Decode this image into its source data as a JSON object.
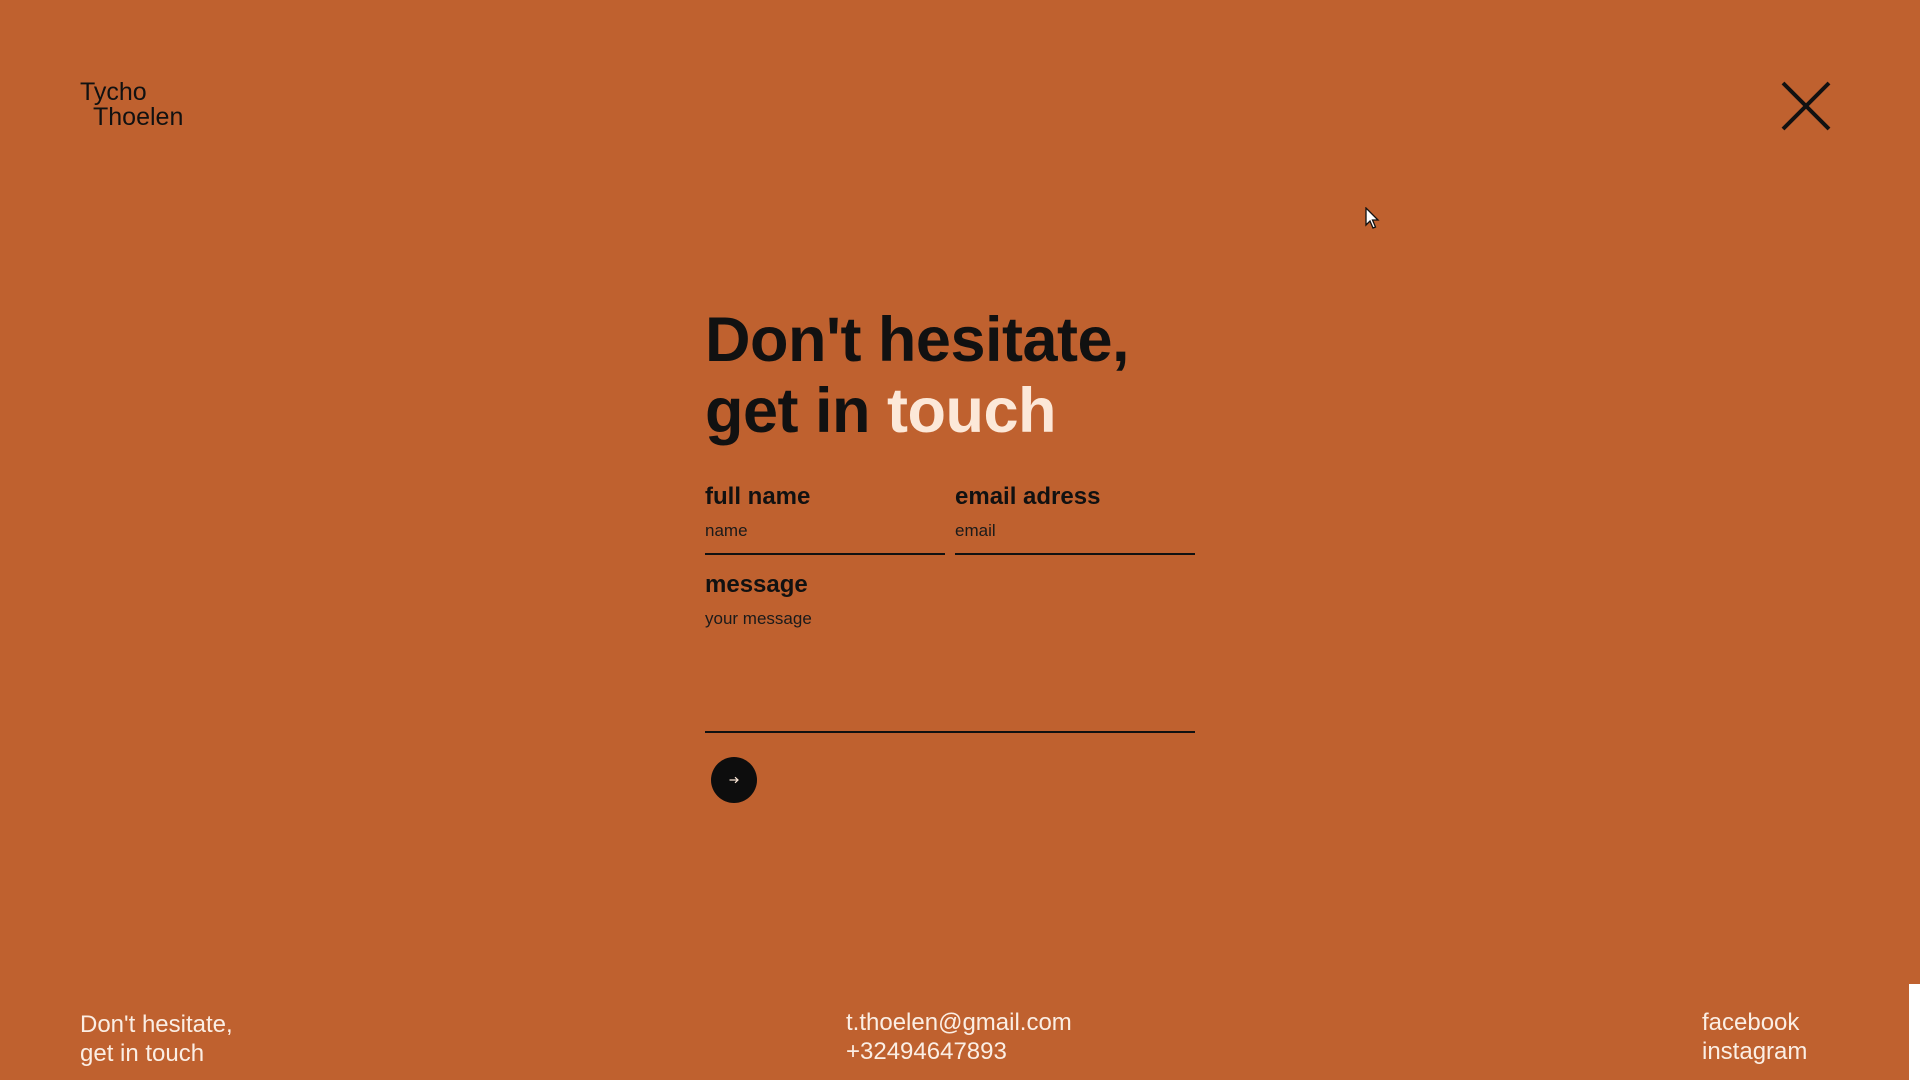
{
  "logo": {
    "line1": "Tycho",
    "line2": "Thoelen"
  },
  "close_icon": "close-icon",
  "headline": {
    "line1": "Don't hesitate,",
    "line2_prefix": "get in ",
    "line2_accent": "touch"
  },
  "form": {
    "name": {
      "label": "full name",
      "placeholder": "name"
    },
    "email": {
      "label": "email adress",
      "placeholder": "email"
    },
    "message": {
      "label": "message",
      "placeholder": "your message"
    },
    "submit_icon": "arrow-right-icon"
  },
  "footer": {
    "tagline_line1": "Don't hesitate,",
    "tagline_line2": "get in touch",
    "email": "t.thoelen@gmail.com",
    "phone": "+32494647893",
    "social": [
      "facebook",
      "instagram"
    ]
  },
  "colors": {
    "background": "#bf612f",
    "text": "#111111",
    "accent": "#fce8d8",
    "footer_text": "#fbeee4"
  }
}
